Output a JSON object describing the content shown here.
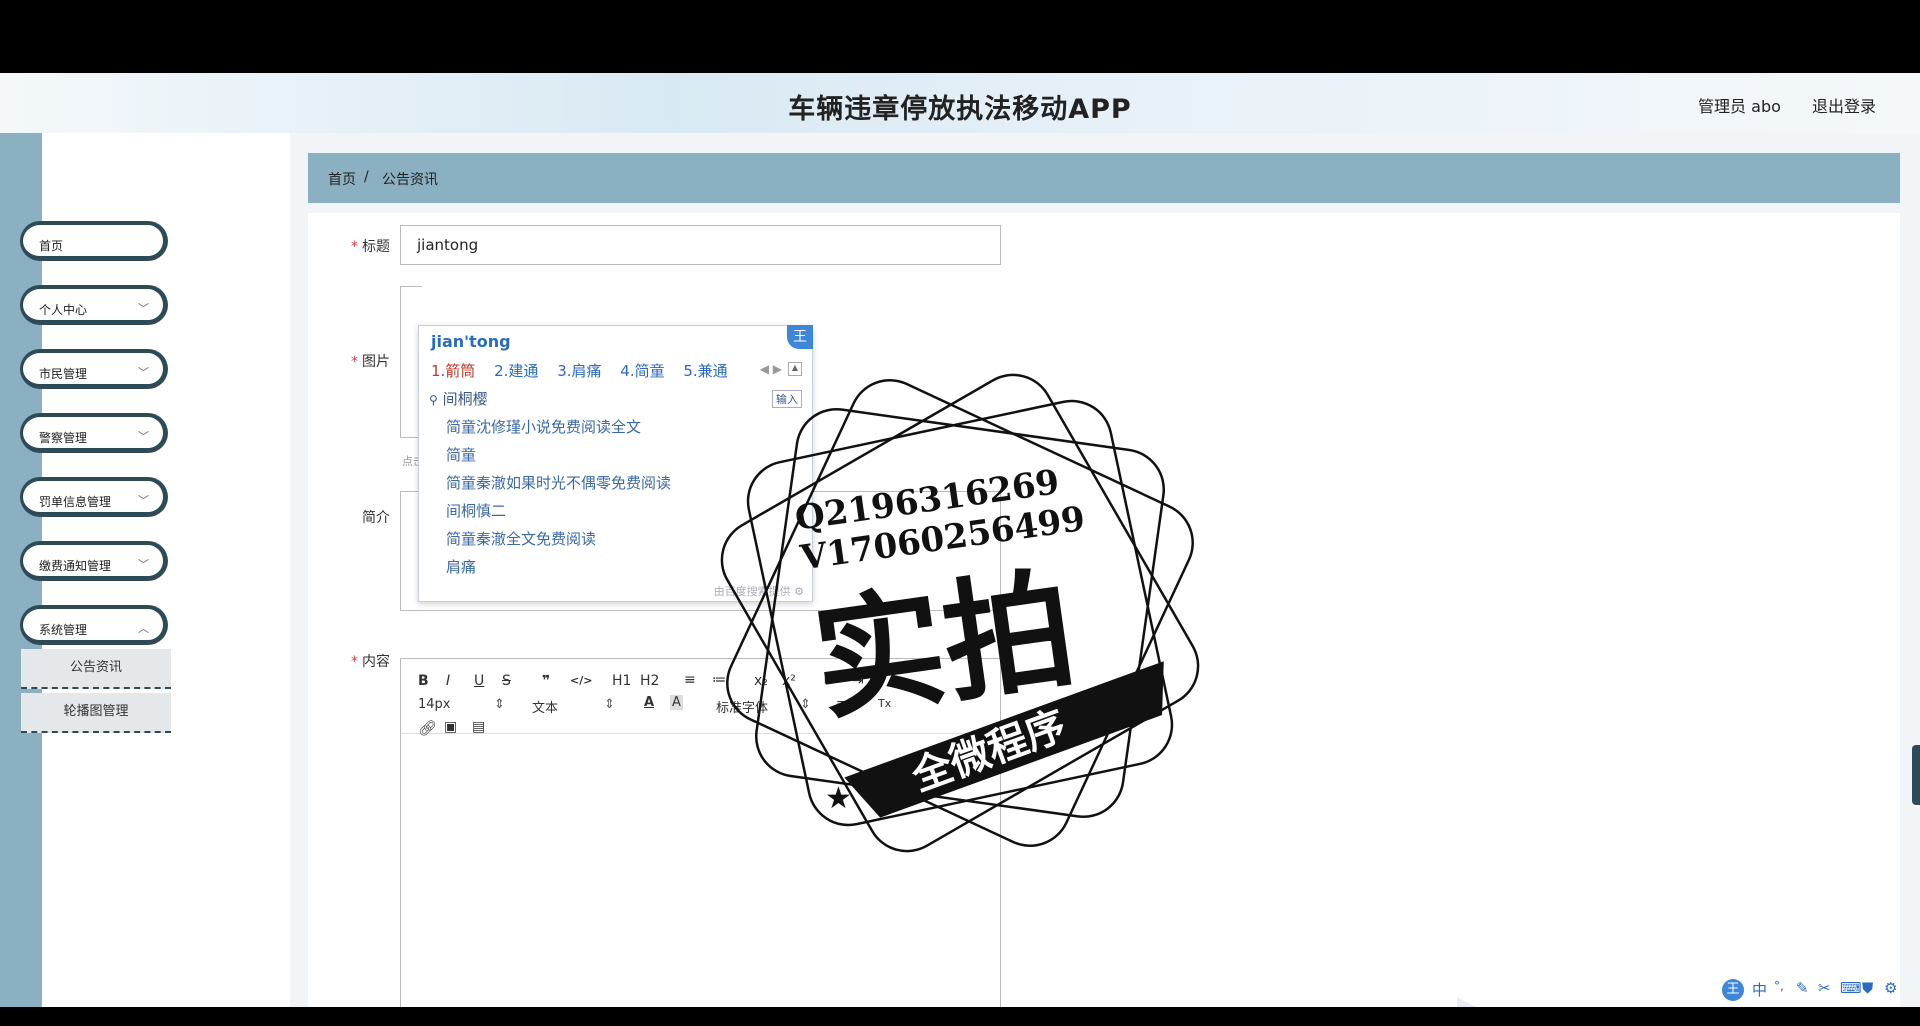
{
  "header": {
    "title": "车辆违章停放执法移动APP",
    "user_label": "管理员 abo",
    "logout_label": "退出登录"
  },
  "sidebar": {
    "items": [
      {
        "label": "首页",
        "expandable": false
      },
      {
        "label": "个人中心",
        "expandable": true
      },
      {
        "label": "市民管理",
        "expandable": true
      },
      {
        "label": "警察管理",
        "expandable": true
      },
      {
        "label": "罚单信息管理",
        "expandable": true
      },
      {
        "label": "缴费通知管理",
        "expandable": true
      },
      {
        "label": "系统管理",
        "expandable": true
      }
    ],
    "sub_items": [
      {
        "label": "公告资讯"
      },
      {
        "label": "轮播图管理"
      }
    ],
    "chevron_icon": "chevron-down-icon"
  },
  "breadcrumb": {
    "home": "首页",
    "separator": "/",
    "current": "公告资讯"
  },
  "form": {
    "title_label": "标题",
    "title_value": "jiantong",
    "image_label": "图片",
    "image_hint": "点击",
    "intro_label": "简介",
    "content_label": "内容"
  },
  "editor": {
    "toolbar_row1": [
      "B",
      "I",
      "U",
      "S",
      "❞",
      "</>",
      "H1",
      "H2",
      "≡",
      "≔",
      "x₂",
      "x²",
      "⇤",
      "⇥"
    ],
    "font_size": "14px",
    "block_type": "文本",
    "font_family": "标准字体"
  },
  "ime": {
    "pinyin": "jian'tong",
    "badge": "王",
    "candidates": [
      "1.箭筒",
      "2.建通",
      "3.肩痛",
      "4.简童",
      "5.兼通"
    ],
    "search_text": "间桐樱",
    "input_btn": "输入",
    "suggestions": [
      "简童沈修瑾小说免费阅读全文",
      "简童",
      "简童秦澈如果时光不偶零免费阅读",
      "间桐慎二",
      "简童秦澈全文免费阅读",
      "肩痛"
    ],
    "footer": "由百度搜索提供"
  },
  "watermark": {
    "qq": "Q2196316269",
    "vx": "V17060256499",
    "big_text": "实拍",
    "ribbon_text": "全微程序"
  },
  "tray": {
    "badge": "王",
    "lang": "中"
  },
  "colors": {
    "sidebar_strip": "#8ab0c2",
    "breadcrumb_bg": "#8ab0c2",
    "menu_border": "#2e4a57",
    "required": "#e03c3c",
    "ime_blue": "#2a6bc2"
  }
}
